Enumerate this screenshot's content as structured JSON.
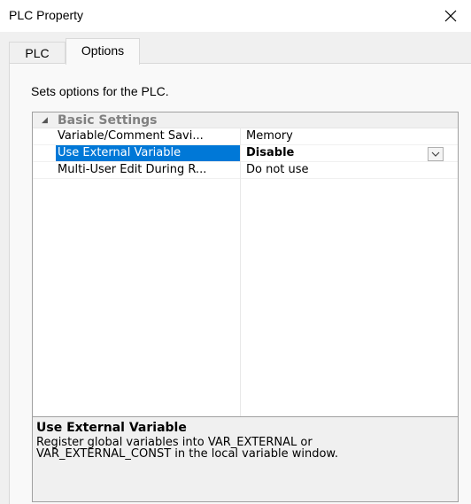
{
  "window": {
    "title": "PLC Property"
  },
  "tabs": [
    {
      "label": "PLC",
      "active": false
    },
    {
      "label": "Options",
      "active": true
    }
  ],
  "panel": {
    "description": "Sets options for the PLC."
  },
  "property_grid": {
    "category": {
      "label": "Basic Settings",
      "expanded": true
    },
    "rows": [
      {
        "name": "Variable/Comment Savi...",
        "value": "Memory",
        "selected": false
      },
      {
        "name": "Use External Variable",
        "value": "Disable",
        "selected": true
      },
      {
        "name": "Multi-User Edit During R...",
        "value": "Do not use",
        "selected": false
      }
    ]
  },
  "help": {
    "title": "Use External Variable",
    "line1": "Register global variables into VAR_EXTERNAL or",
    "line2": "VAR_EXTERNAL_CONST in the local variable window."
  },
  "colors": {
    "selection": "#0078d7",
    "background": "#f0f0f0",
    "panel": "#f9f9f9"
  },
  "icons": {
    "close": "close-icon",
    "expander": "triangle-expand-icon",
    "dropdown": "chevron-down-icon"
  }
}
